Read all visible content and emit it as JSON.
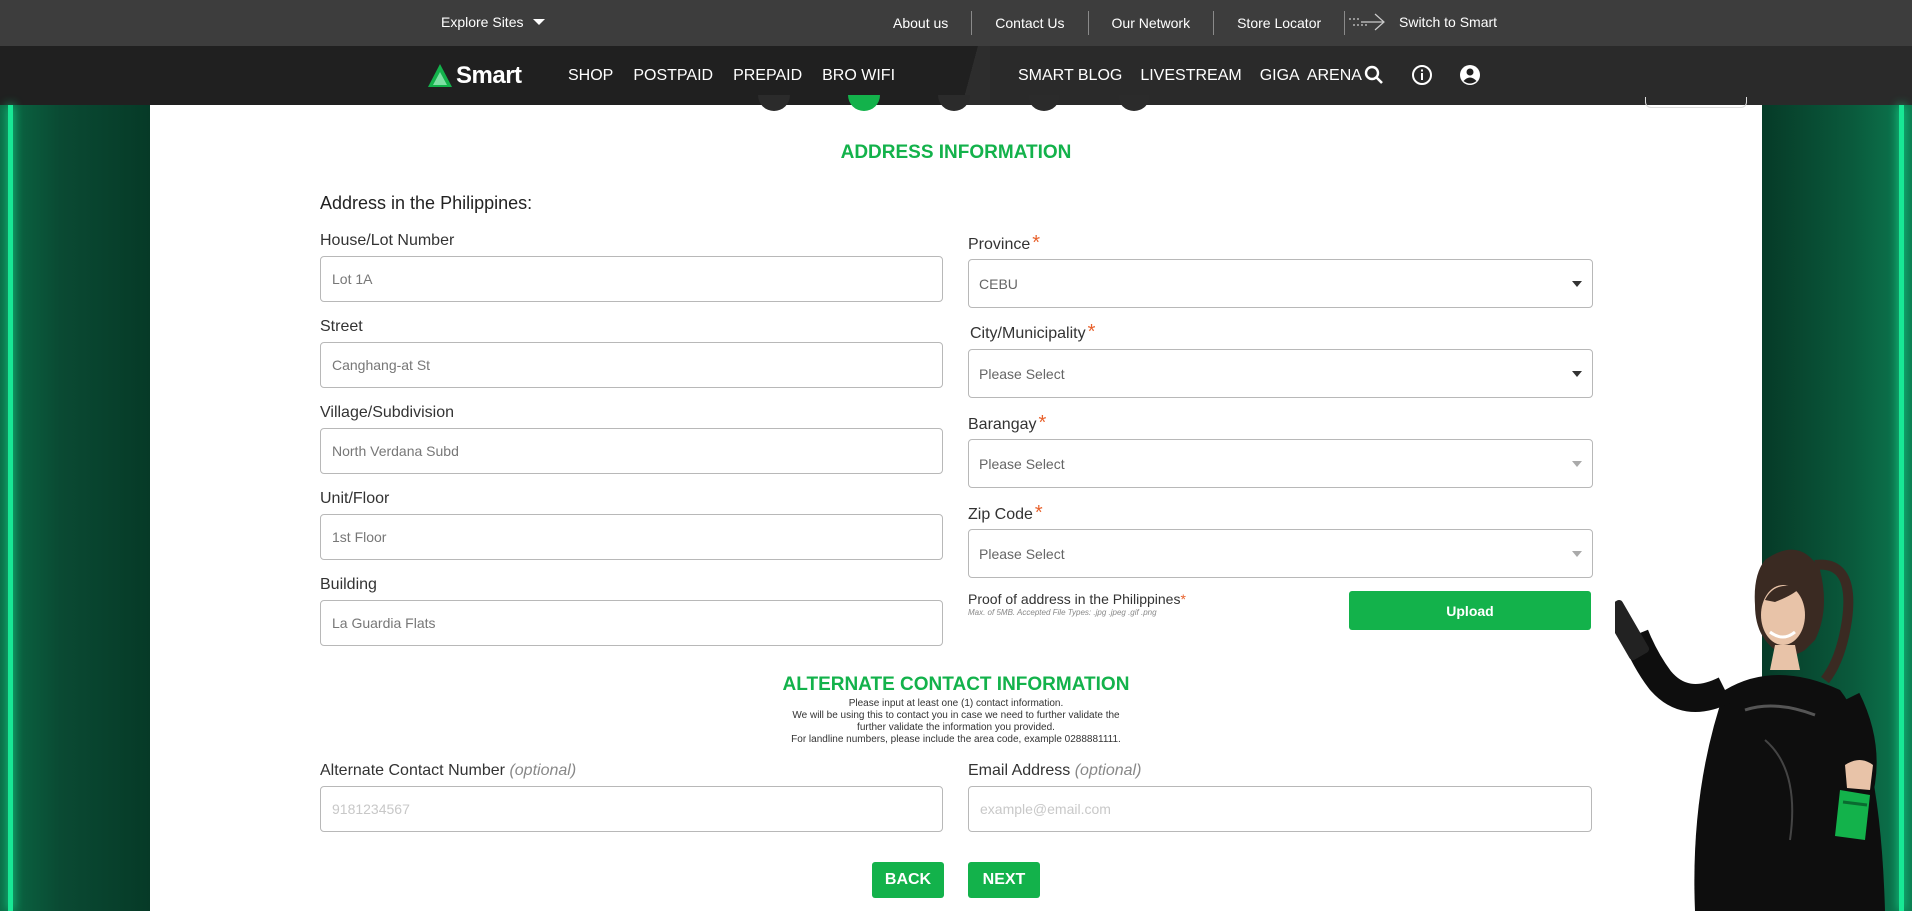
{
  "topbar": {
    "explore_label": "Explore Sites",
    "links": [
      "About us",
      "Contact Us",
      "Our Network",
      "Store Locator"
    ],
    "switch_label": "Switch to Smart"
  },
  "nav": {
    "logo_text": "Smart",
    "left_items": [
      "SHOP",
      "POSTPAID",
      "PREPAID",
      "BRO WIFI"
    ],
    "right_items": [
      "SMART BLOG",
      "LIVESTREAM",
      "GIGA  ARENA"
    ],
    "icons": [
      "search-icon",
      "info-icon",
      "account-icon"
    ]
  },
  "address": {
    "section_title": "ADDRESS INFORMATION",
    "heading": "Address in the Philippines:",
    "house_label": "House/Lot Number",
    "house_value": "Lot 1A",
    "street_label": "Street",
    "street_value": "Canghang-at St",
    "village_label": "Village/Subdivision",
    "village_value": "North Verdana Subd",
    "unit_label": "Unit/Floor",
    "unit_value": "1st Floor",
    "building_label": "Building",
    "building_value": "La Guardia Flats",
    "province_label": "Province",
    "province_value": "CEBU",
    "city_label": "City/Municipality",
    "city_value": "Please Select",
    "barangay_label": "Barangay",
    "barangay_value": "Please Select",
    "zip_label": "Zip Code",
    "zip_value": "Please Select",
    "required_mark": "*",
    "proof_label": "Proof of address  in the Philippines",
    "proof_note": "Max. of 5MB. Accepted File Types: .jpg .jpeg .gif .png",
    "upload_label": "Upload"
  },
  "alternate": {
    "section_title": "ALTERNATE CONTACT INFORMATION",
    "notes": [
      "Please input at least one (1) contact information.",
      "We will be using this to contact you in case we need to further validate the",
      "further validate the information you provided.",
      "For landline numbers, please include the area code, example 0288881111."
    ],
    "contact_label": "Alternate Contact Number",
    "contact_optional": "(optional)",
    "contact_placeholder": "9181234567",
    "email_label": "Email Address",
    "email_optional": "(optional)",
    "email_placeholder": "example@email.com"
  },
  "buttons": {
    "back": "BACK",
    "next": "NEXT"
  },
  "colors": {
    "accent": "#13b24b",
    "required": "#e8612c"
  }
}
